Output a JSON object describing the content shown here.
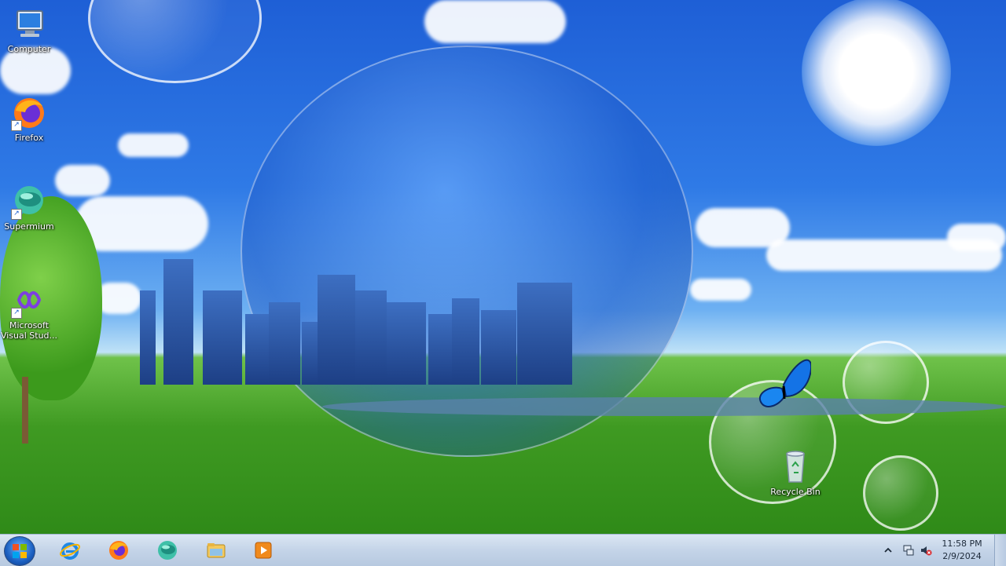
{
  "desktop": {
    "icons": [
      {
        "label": "Computer",
        "icon": "computer-icon"
      },
      {
        "label": "Firefox",
        "icon": "firefox-icon"
      },
      {
        "label": "Supermium",
        "icon": "supermium-icon"
      },
      {
        "label": "Microsoft Visual Stud...",
        "icon": "visual-studio-icon"
      },
      {
        "label": "Recycle Bin",
        "icon": "recycle-bin-icon"
      }
    ]
  },
  "taskbar": {
    "start": {
      "icon": "windows-start-icon"
    },
    "pinned": [
      {
        "name": "Internet Explorer",
        "icon": "internet-explorer-icon"
      },
      {
        "name": "Firefox",
        "icon": "firefox-icon"
      },
      {
        "name": "Supermium",
        "icon": "supermium-icon"
      },
      {
        "name": "File Explorer",
        "icon": "folder-icon"
      },
      {
        "name": "Media Player",
        "icon": "media-player-icon"
      }
    ],
    "tray": {
      "icons": [
        "show-hidden-icons-chevron",
        "network-icon",
        "volume-muted-icon"
      ],
      "time": "11:58 PM",
      "date": "2/9/2024"
    }
  },
  "colors": {
    "taskbar": "#c4d4e8",
    "sky": "#2f7ae6",
    "grass": "#3f9a22"
  }
}
